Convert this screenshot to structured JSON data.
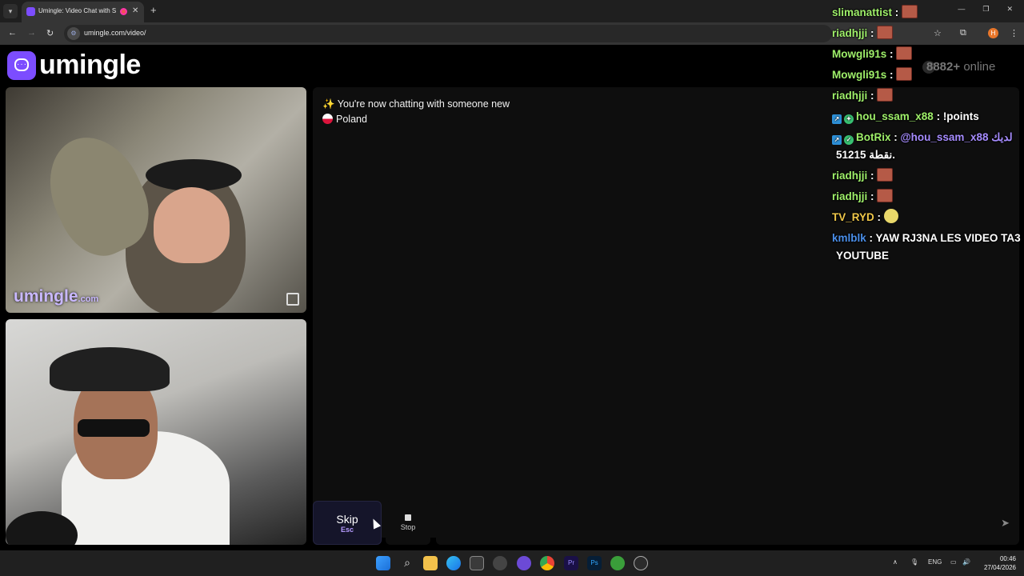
{
  "browser": {
    "tab_title": "Umingle: Video Chat with S",
    "url": "umingle.com/video/"
  },
  "brand": {
    "name": "umingle",
    "online_count": "8882+",
    "online_label": "online",
    "accent_color": "#7c4dff"
  },
  "remote_video": {
    "watermark": "umingle",
    "watermark_suffix": ".com"
  },
  "chat": {
    "system_message": "✨ You're now chatting with someone new",
    "country": "Poland"
  },
  "controls": {
    "skip_label": "Skip",
    "skip_key": "Esc",
    "stop_label": "Stop"
  },
  "stream_chat": [
    {
      "user": "slimanattist",
      "text": "",
      "emote": "emote"
    },
    {
      "user": "riadhjji",
      "text": "",
      "emote": "emote"
    },
    {
      "user": "Mowgli91s",
      "text": "",
      "emote": "emote"
    },
    {
      "user": "Mowgli91s",
      "text": "",
      "emote": "emote"
    },
    {
      "user": "riadhjji",
      "text": "",
      "emote": "emote"
    },
    {
      "user": "hou_ssam_x88",
      "text": "!points",
      "emote": ""
    },
    {
      "user": "BotRix",
      "text": "@hou_ssam_x88 لديك",
      "text2": "51215 نقطة.",
      "emote": ""
    },
    {
      "user": "riadhjji",
      "text": "",
      "emote": "emote"
    },
    {
      "user": "riadhjji",
      "text": "",
      "emote": "emote"
    },
    {
      "user": "TV_RYD",
      "text": "",
      "emote": "face"
    },
    {
      "user": "kmlblk",
      "text": "YAW RJ3NA LES VIDEO TA3",
      "text2": "YOUTUBE",
      "emote": ""
    }
  ],
  "taskbar": {
    "language": "ENG",
    "time": "00:46",
    "date": "27/04/2026"
  }
}
